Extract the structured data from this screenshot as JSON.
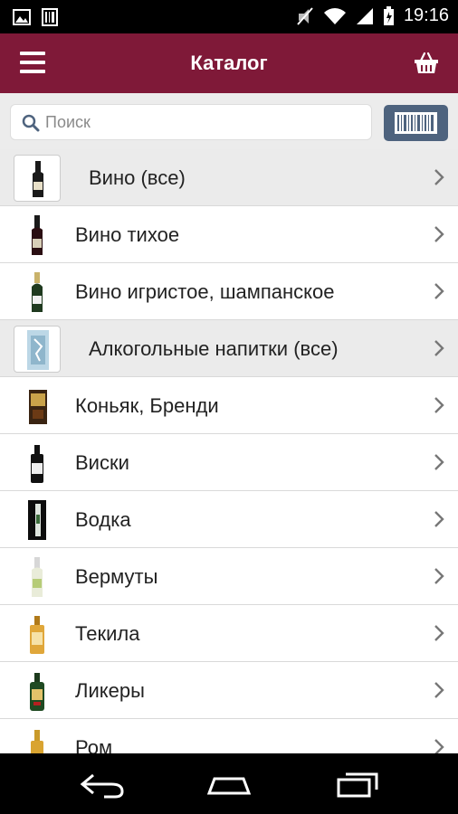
{
  "status_bar": {
    "time": "19:16"
  },
  "app_bar": {
    "title": "Каталог"
  },
  "search": {
    "placeholder": "Поиск"
  },
  "catalog": {
    "items": [
      {
        "label": "Вино (все)"
      },
      {
        "label": "Вино тихое"
      },
      {
        "label": "Вино игристое, шампанское"
      },
      {
        "label": "Алкогольные напитки (все)"
      },
      {
        "label": "Коньяк, Бренди"
      },
      {
        "label": "Виски"
      },
      {
        "label": "Водка"
      },
      {
        "label": "Вермуты"
      },
      {
        "label": "Текила"
      },
      {
        "label": "Ликеры"
      },
      {
        "label": "Ром"
      }
    ]
  },
  "icons": {
    "menu": "hamburger-menu-icon",
    "cart": "basket-icon",
    "search": "magnifier-icon",
    "barcode": "barcode-icon",
    "chevron": "chevron-right-icon"
  },
  "colors": {
    "app_bar": "#7f1938",
    "barcode_button": "#4e637e",
    "group_row": "#ebebeb"
  }
}
